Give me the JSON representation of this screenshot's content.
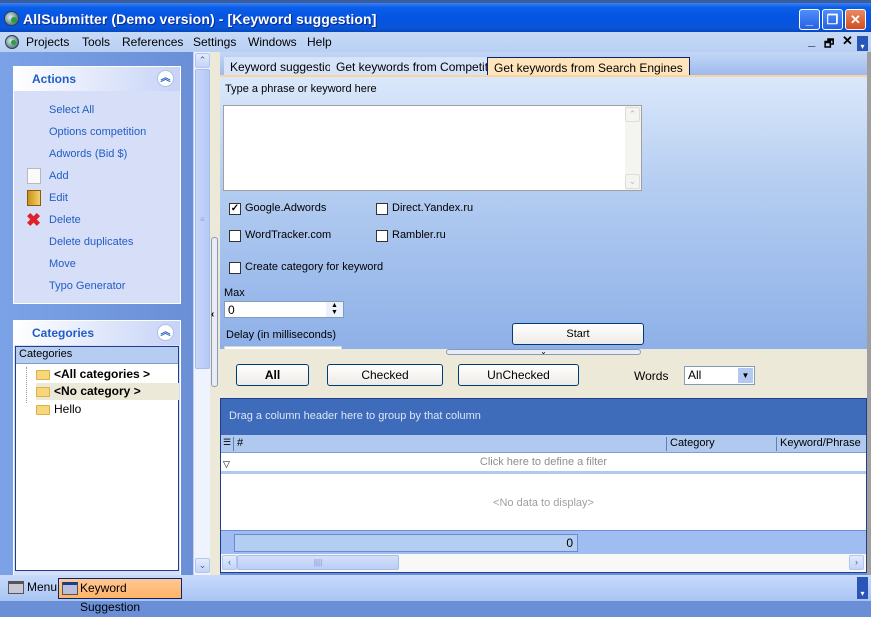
{
  "window": {
    "title": "AllSubmitter (Demo version) - [Keyword suggestion]",
    "controls": {
      "minimize": "_",
      "restore": "❐",
      "close": "✕"
    }
  },
  "menubar": {
    "items": [
      "Projects",
      "Tools",
      "References",
      "Settings",
      "Windows",
      "Help"
    ],
    "mdi_controls": {
      "minimize": "_",
      "restore": "🗗",
      "close": "✕"
    }
  },
  "actions_panel": {
    "title": "Actions",
    "items": [
      {
        "label": "Select All",
        "icon": ""
      },
      {
        "label": "Options competition",
        "icon": ""
      },
      {
        "label": "Adwords (Bid $)",
        "icon": ""
      },
      {
        "label": "Add",
        "icon": "blank-page-icon"
      },
      {
        "label": "Edit",
        "icon": "folder-edit-icon"
      },
      {
        "label": "Delete",
        "icon": "red-x-icon"
      },
      {
        "label": "Delete duplicates",
        "icon": ""
      },
      {
        "label": "Move",
        "icon": ""
      },
      {
        "label": "Typo Generator",
        "icon": ""
      }
    ]
  },
  "categories_panel": {
    "title": "Categories",
    "column_header": "Categories",
    "nodes": [
      {
        "label": "<All categories >",
        "bold": true,
        "selected": false
      },
      {
        "label": "<No category >",
        "bold": true,
        "selected": true
      },
      {
        "label": "Hello",
        "bold": false,
        "selected": false
      }
    ]
  },
  "tabs": [
    {
      "label": "Keyword suggestion",
      "active": false
    },
    {
      "label": "Get keywords from Competitors",
      "active": false
    },
    {
      "label": "Get keywords from Search Engines",
      "active": true
    }
  ],
  "form": {
    "phrase_label": "Type a phrase or keyword here",
    "phrase_value": "",
    "checkboxes": [
      {
        "label": "Google.Adwords",
        "checked": true
      },
      {
        "label": "Direct.Yandex.ru",
        "checked": false
      },
      {
        "label": "WordTracker.com",
        "checked": false
      },
      {
        "label": "Rambler.ru",
        "checked": false
      },
      {
        "label": "Create category for keyword",
        "checked": false
      }
    ],
    "max_label": "Max",
    "max_value": "0",
    "delay_label": "Delay (in milliseconds)",
    "start_button": "Start"
  },
  "filter_bar": {
    "buttons": [
      "All",
      "Checked",
      "UnChecked"
    ],
    "words_label": "Words",
    "words_value": "All"
  },
  "grid": {
    "group_hint": "Drag a column header here to group by that column",
    "columns": [
      "#",
      "Category",
      "Keyword/Phrase"
    ],
    "filter_hint": "Click here to define a filter",
    "empty_text": "<No data to display>",
    "footer_count": "0"
  },
  "taskbar": {
    "items": [
      {
        "label": "Menu",
        "active": false
      },
      {
        "label": "Keyword Suggestion",
        "active": true
      }
    ]
  }
}
